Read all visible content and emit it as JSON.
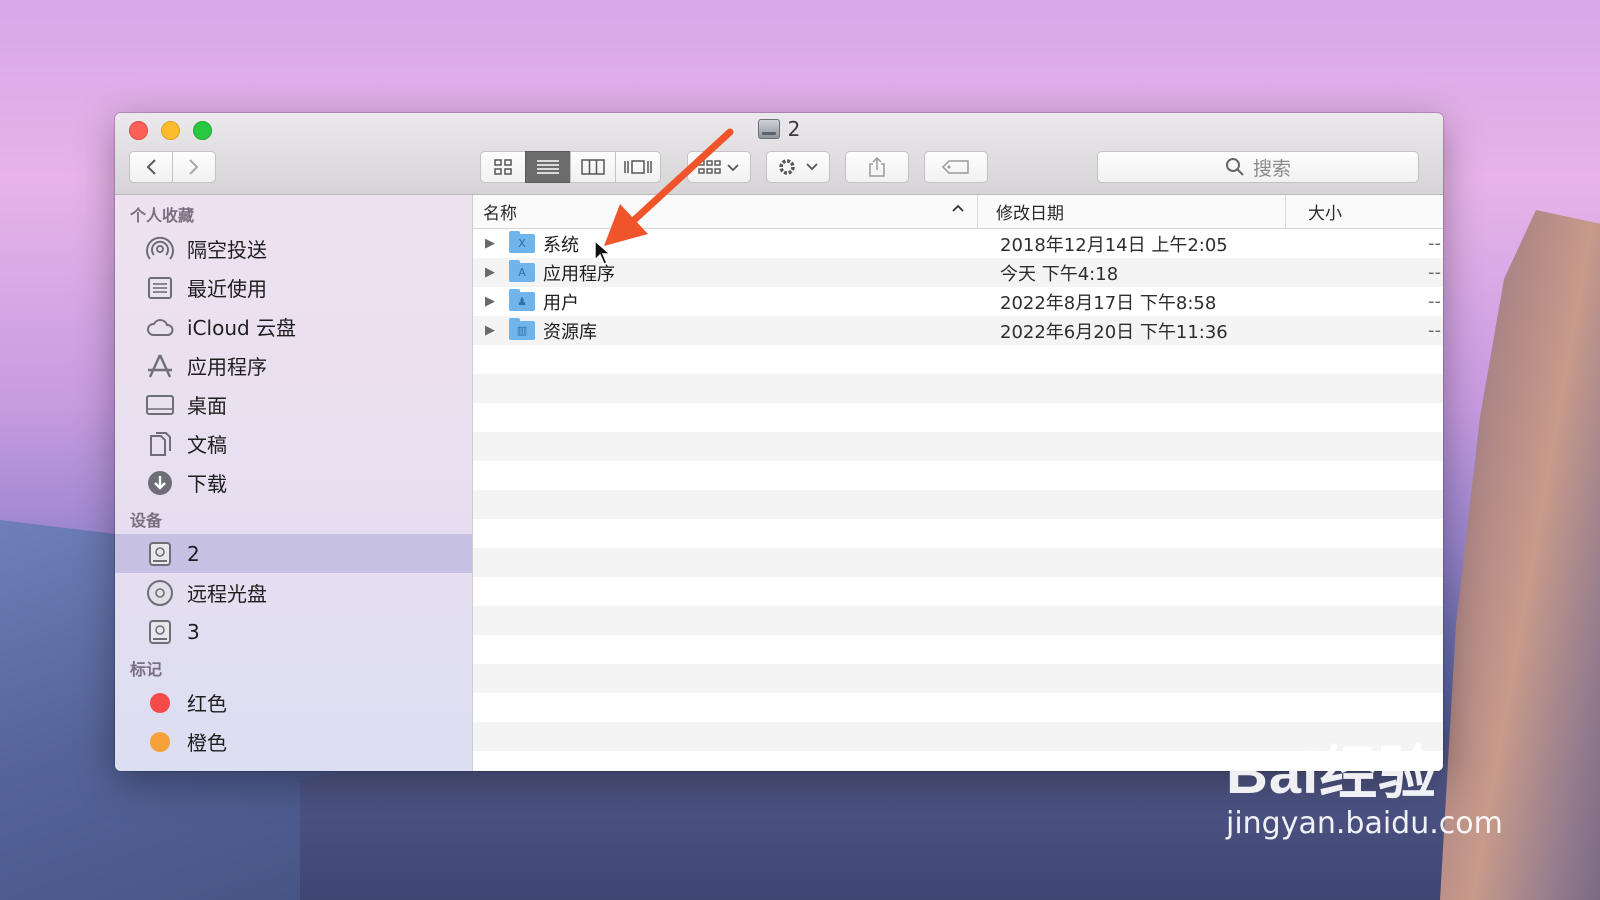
{
  "window": {
    "title": "2"
  },
  "toolbar": {
    "back_icon": "chevron-left-icon",
    "forward_icon": "chevron-right-icon",
    "views": [
      {
        "name": "icon-view",
        "glyph": "▦",
        "active": false
      },
      {
        "name": "list-view",
        "glyph": "☰",
        "active": true
      },
      {
        "name": "column-view",
        "glyph": "▥",
        "active": false
      },
      {
        "name": "gallery-view",
        "glyph": "▭",
        "active": false
      }
    ],
    "search_placeholder": "搜索"
  },
  "sidebar": {
    "favorites_title": "个人收藏",
    "favorites": [
      {
        "label": "隔空投送",
        "icon": "airdrop-icon"
      },
      {
        "label": "最近使用",
        "icon": "recents-icon"
      },
      {
        "label": "iCloud 云盘",
        "icon": "icloud-icon"
      },
      {
        "label": "应用程序",
        "icon": "applications-icon"
      },
      {
        "label": "桌面",
        "icon": "desktop-icon"
      },
      {
        "label": "文稿",
        "icon": "documents-icon"
      },
      {
        "label": "下载",
        "icon": "downloads-icon"
      }
    ],
    "devices_title": "设备",
    "devices": [
      {
        "label": "2",
        "icon": "disk-icon",
        "selected": true
      },
      {
        "label": "远程光盘",
        "icon": "optical-disc-icon",
        "selected": false
      },
      {
        "label": "3",
        "icon": "disk-icon",
        "selected": false
      }
    ],
    "tags_title": "标记",
    "tags": [
      {
        "label": "红色",
        "color": "#f5494a"
      },
      {
        "label": "橙色",
        "color": "#f7a13a"
      }
    ]
  },
  "columns": {
    "name": "名称",
    "date": "修改日期",
    "size": "大小"
  },
  "files": [
    {
      "name": "系统",
      "date": "2018年12月14日 上午2:05",
      "size": "--",
      "badge": "X"
    },
    {
      "name": "应用程序",
      "date": "今天 下午4:18",
      "size": "--",
      "badge": "A"
    },
    {
      "name": "用户",
      "date": "2022年8月17日 下午8:58",
      "size": "--",
      "badge": "♟"
    },
    {
      "name": "资源库",
      "date": "2022年6月20日 下午11:36",
      "size": "--",
      "badge": "▥"
    }
  ],
  "colors": {
    "accent_arrow": "#f0542b",
    "selection": "#c6c0e2",
    "folder": "#6fb4ea"
  },
  "watermark": {
    "logo": "Bai经验",
    "url": "jingyan.baidu.com"
  }
}
